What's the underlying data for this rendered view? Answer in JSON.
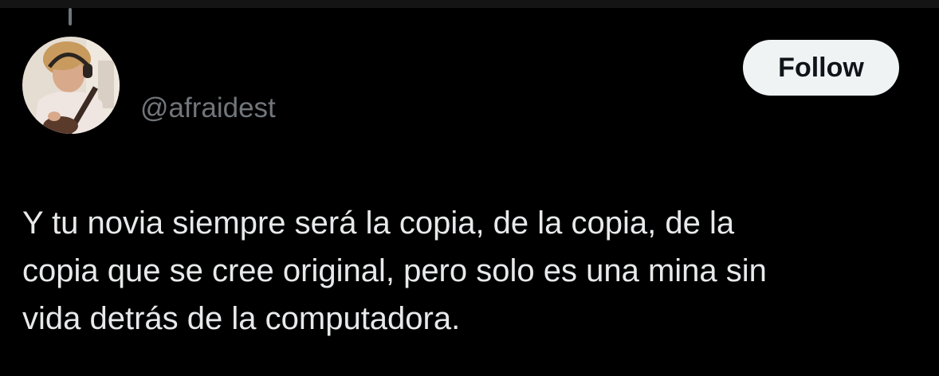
{
  "tweet": {
    "handle": "@afraidest",
    "follow_label": "Follow",
    "avatar_icon": "profile-photo-avatar",
    "text_lines": [
      "Y tu novia siempre será la copia, de la copia, de la",
      "copia que se cree original, pero solo es una mina sin",
      "vida detrás de la computadora."
    ]
  },
  "colors": {
    "background": "#000000",
    "text": "#e7e9ea",
    "handle": "#71767b",
    "button_bg": "#eff3f4",
    "button_text": "#0f1419"
  }
}
